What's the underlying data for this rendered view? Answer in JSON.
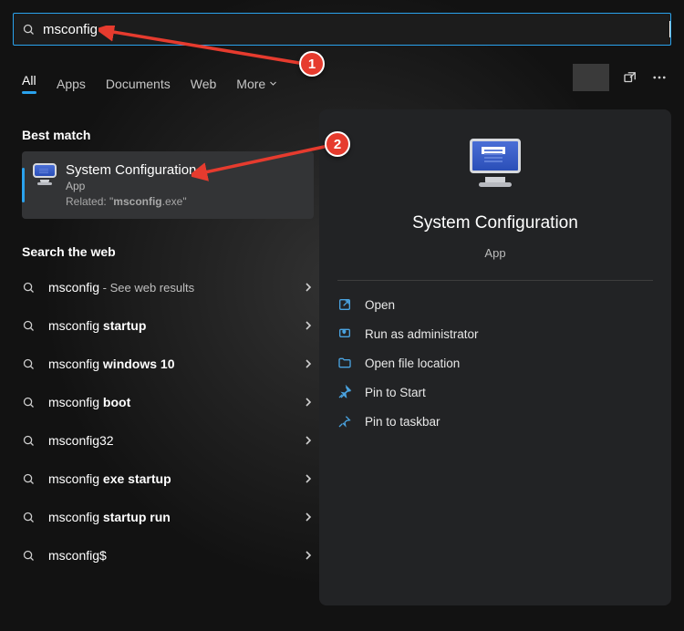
{
  "search": {
    "value": "msconfig"
  },
  "tabs": {
    "all": "All",
    "apps": "Apps",
    "documents": "Documents",
    "web": "Web",
    "more": "More"
  },
  "best_match": {
    "header": "Best match",
    "title": "System Configuration",
    "subtitle": "App",
    "related_prefix": "Related: \"",
    "related_bold": "msconfig",
    "related_suffix": ".exe\""
  },
  "web_search": {
    "header": "Search the web",
    "items": [
      {
        "prefix": "msconfig",
        "bold": "",
        "hint": " - See web results"
      },
      {
        "prefix": "msconfig ",
        "bold": "startup",
        "hint": ""
      },
      {
        "prefix": "msconfig ",
        "bold": "windows 10",
        "hint": ""
      },
      {
        "prefix": "msconfig ",
        "bold": "boot",
        "hint": ""
      },
      {
        "prefix": "msconfig32",
        "bold": "",
        "hint": ""
      },
      {
        "prefix": "msconfig ",
        "bold": "exe startup",
        "hint": ""
      },
      {
        "prefix": "msconfig ",
        "bold": "startup run",
        "hint": ""
      },
      {
        "prefix": "msconfig$",
        "bold": "",
        "hint": ""
      }
    ]
  },
  "preview": {
    "title": "System Configuration",
    "subtitle": "App",
    "actions": {
      "open": "Open",
      "run_admin": "Run as administrator",
      "open_loc": "Open file location",
      "pin_start": "Pin to Start",
      "pin_taskbar": "Pin to taskbar"
    }
  },
  "annotations": {
    "b1": "1",
    "b2": "2"
  }
}
